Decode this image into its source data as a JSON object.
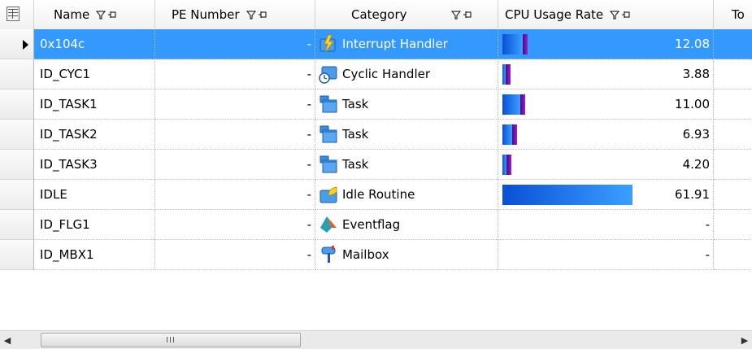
{
  "columns": {
    "name": "Name",
    "pe_number": "PE Number",
    "category": "Category",
    "cpu_usage_rate": "CPU Usage Rate",
    "total_truncated": "To"
  },
  "rows": [
    {
      "name": "0x104c",
      "pe": "-",
      "category": "Interrupt Handler",
      "icon": "interrupt-handler-icon",
      "cpu": "12.08",
      "cpu_value": 12.08,
      "selected": true
    },
    {
      "name": "ID_CYC1",
      "pe": "-",
      "category": "Cyclic Handler",
      "icon": "cyclic-handler-icon",
      "cpu": "3.88",
      "cpu_value": 3.88,
      "selected": false
    },
    {
      "name": "ID_TASK1",
      "pe": "-",
      "category": "Task",
      "icon": "task-icon",
      "cpu": "11.00",
      "cpu_value": 11.0,
      "selected": false
    },
    {
      "name": "ID_TASK2",
      "pe": "-",
      "category": "Task",
      "icon": "task-icon",
      "cpu": "6.93",
      "cpu_value": 6.93,
      "selected": false
    },
    {
      "name": "ID_TASK3",
      "pe": "-",
      "category": "Task",
      "icon": "task-icon",
      "cpu": "4.20",
      "cpu_value": 4.2,
      "selected": false
    },
    {
      "name": "IDLE",
      "pe": "-",
      "category": "Idle Routine",
      "icon": "idle-routine-icon",
      "cpu": "61.91",
      "cpu_value": 61.91,
      "selected": false
    },
    {
      "name": "ID_FLG1",
      "pe": "-",
      "category": "Eventflag",
      "icon": "eventflag-icon",
      "cpu": "-",
      "cpu_value": null,
      "selected": false
    },
    {
      "name": "ID_MBX1",
      "pe": "-",
      "category": "Mailbox",
      "icon": "mailbox-icon",
      "cpu": "-",
      "cpu_value": null,
      "selected": false
    }
  ],
  "scrollbar": {
    "grip": "III"
  },
  "colors": {
    "selection": "#3399ff",
    "bar_blue": "#1e78e6",
    "bar_purple": "#6a1199"
  }
}
